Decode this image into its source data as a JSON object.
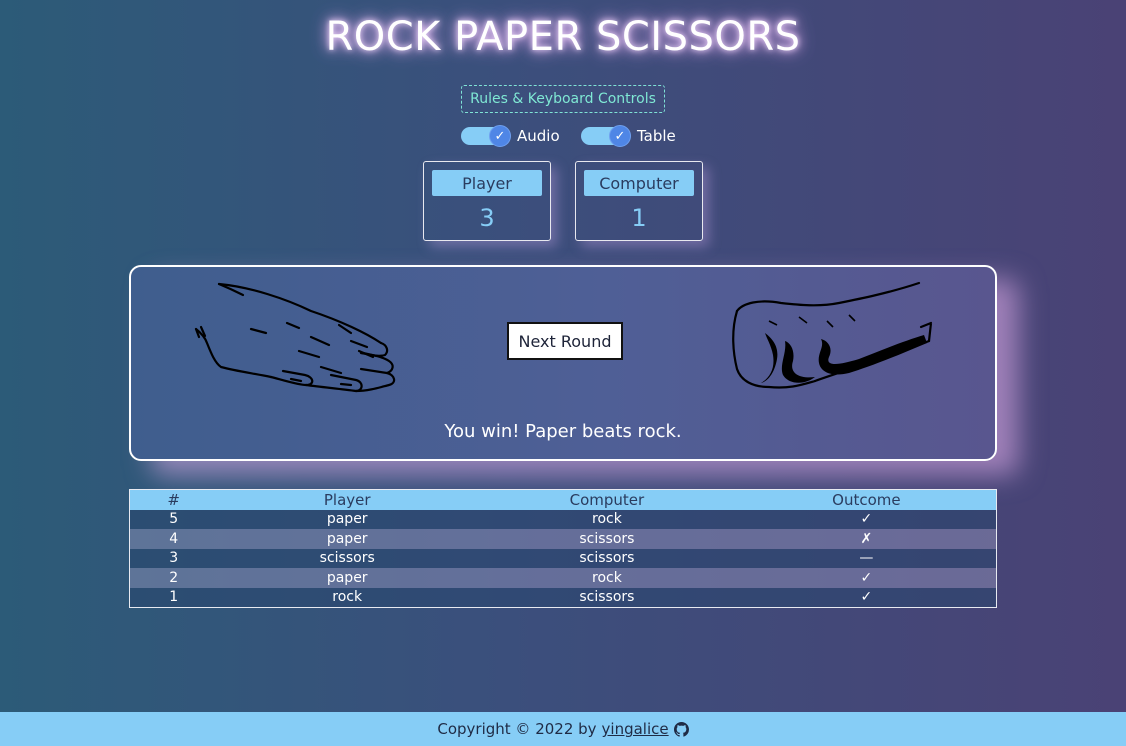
{
  "title": "ROCK PAPER SCISSORS",
  "rules_button": "Rules & Keyboard Controls",
  "toggles": [
    {
      "label": "Audio",
      "checked": true,
      "check_glyph": "✓"
    },
    {
      "label": "Table",
      "checked": true,
      "check_glyph": "✓"
    }
  ],
  "scores": {
    "player": {
      "label": "Player",
      "value": "3"
    },
    "computer": {
      "label": "Computer",
      "value": "1"
    }
  },
  "arena": {
    "player_choice_icon": "paper-hand-icon",
    "computer_choice_icon": "rock-fist-icon",
    "next_button": "Next Round",
    "result": "You win! Paper beats rock."
  },
  "history": {
    "headers": [
      "#",
      "Player",
      "Computer",
      "Outcome"
    ],
    "rows": [
      {
        "num": "5",
        "player": "paper",
        "computer": "rock",
        "outcome": "✓",
        "status": "win"
      },
      {
        "num": "4",
        "player": "paper",
        "computer": "scissors",
        "outcome": "✗",
        "status": "lose"
      },
      {
        "num": "3",
        "player": "scissors",
        "computer": "scissors",
        "outcome": "—",
        "status": "tie"
      },
      {
        "num": "2",
        "player": "paper",
        "computer": "rock",
        "outcome": "✓",
        "status": "win"
      },
      {
        "num": "1",
        "player": "rock",
        "computer": "scissors",
        "outcome": "✓",
        "status": "win"
      }
    ]
  },
  "footer": {
    "text": "Copyright © 2022 by",
    "author": "yingalice",
    "icon": "github-icon"
  },
  "colors": {
    "accent": "#86cdf6",
    "win": "#58e37d",
    "lose": "#ff4a67",
    "rules": "#7fe8d4"
  }
}
